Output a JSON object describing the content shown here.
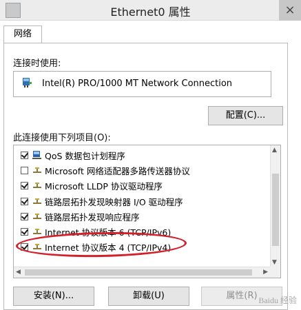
{
  "window": {
    "title": "Ethernet0 属性",
    "close_glyph": "×",
    "system_icon": "network-adapter-icon"
  },
  "tabs": [
    {
      "label": "网络",
      "selected": true
    }
  ],
  "connect_using": {
    "label": "连接时使用:",
    "adapter_name": "Intel(R) PRO/1000 MT Network Connection",
    "adapter_icon": "network-card-icon"
  },
  "configure_button": "配置(C)...",
  "items_label": "此连接使用下列项目(O):",
  "items": [
    {
      "label": "QoS 数据包计划程序",
      "checked": true,
      "icon": "qos-scheduler-icon"
    },
    {
      "label": "Microsoft 网络适配器多路传送器协议",
      "checked": false,
      "icon": "protocol-icon"
    },
    {
      "label": "Microsoft LLDP 协议驱动程序",
      "checked": true,
      "icon": "protocol-icon"
    },
    {
      "label": "链路层拓扑发现映射器 I/O 驱动程序",
      "checked": true,
      "icon": "protocol-icon"
    },
    {
      "label": "链路层拓扑发现响应程序",
      "checked": true,
      "icon": "protocol-icon"
    },
    {
      "label": "Internet 协议版本 6 (TCP/IPv6)",
      "checked": true,
      "icon": "protocol-icon"
    },
    {
      "label": "Internet 协议版本 4 (TCP/IPv4)",
      "checked": true,
      "icon": "protocol-icon",
      "highlighted": true
    }
  ],
  "buttons": {
    "install": "安装(N)...",
    "uninstall": "卸载(U)",
    "properties": "属性(R)"
  },
  "watermark": "Baidu 经验",
  "colors": {
    "highlight_ring": "#d4202a",
    "titlebar": "#ececec"
  }
}
